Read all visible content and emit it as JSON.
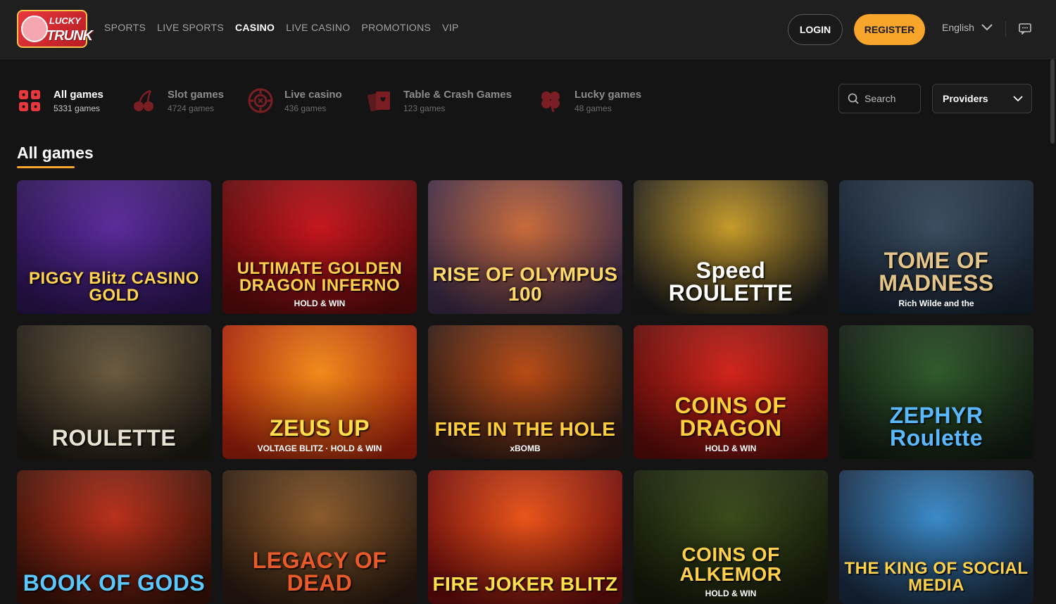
{
  "brand": {
    "logo_line1": "LUCKY",
    "logo_line2": "TRUNK"
  },
  "nav": [
    {
      "label": "SPORTS",
      "active": false
    },
    {
      "label": "LIVE SPORTS",
      "active": false
    },
    {
      "label": "CASINO",
      "active": true
    },
    {
      "label": "LIVE CASINO",
      "active": false
    },
    {
      "label": "PROMOTIONS",
      "active": false
    },
    {
      "label": "VIP",
      "active": false
    }
  ],
  "header": {
    "login_label": "LOGIN",
    "register_label": "REGISTER",
    "language": "English"
  },
  "categories": [
    {
      "title": "All games",
      "count": "5331 games",
      "icon": "grid-icon",
      "active": true
    },
    {
      "title": "Slot games",
      "count": "4724 games",
      "icon": "cherry-icon",
      "active": false
    },
    {
      "title": "Live casino",
      "count": "436 games",
      "icon": "roulette-chip-icon",
      "active": false
    },
    {
      "title": "Table & Crash Games",
      "count": "123 games",
      "icon": "cards-icon",
      "active": false
    },
    {
      "title": "Lucky games",
      "count": "48 games",
      "icon": "clover-icon",
      "active": false
    }
  ],
  "filters": {
    "search_label": "Search",
    "providers_label": "Providers"
  },
  "section": {
    "title": "All games"
  },
  "games": [
    {
      "title": "PIGGY Blitz CASINO GOLD",
      "sub": "",
      "bg": "#5a2a9a",
      "bg2": "#2a1450",
      "fg": "#ffd34d"
    },
    {
      "title": "ULTIMATE GOLDEN DRAGON INFERNO",
      "sub": "HOLD & WIN",
      "bg": "#c4161c",
      "bg2": "#5a0a0c",
      "fg": "#ffcf4a"
    },
    {
      "title": "RISE OF OLYMPUS 100",
      "sub": "",
      "bg": "#c86a3a",
      "bg2": "#3a2a48",
      "fg": "#ffd86a"
    },
    {
      "title": "Speed ROULETTE",
      "sub": "",
      "bg": "#c59a2a",
      "bg2": "#1c1c1c",
      "fg": "#ffffff"
    },
    {
      "title": "TOME OF MADNESS",
      "sub": "Rich Wilde and the",
      "bg": "#3a4c5e",
      "bg2": "#162230",
      "fg": "#e6c58a"
    },
    {
      "title": "ROULETTE",
      "sub": "",
      "bg": "#6a5a3e",
      "bg2": "#1e1a14",
      "fg": "#e8e2d2"
    },
    {
      "title": "ZEUS UP",
      "sub": "VOLTAGE BLITZ · HOLD & WIN",
      "bg": "#f08a1a",
      "bg2": "#a2200c",
      "fg": "#ffe04a"
    },
    {
      "title": "FIRE IN THE HOLE",
      "sub": "xBOMB",
      "bg": "#b84a14",
      "bg2": "#2a1a16",
      "fg": "#ffcc3a"
    },
    {
      "title": "COINS OF DRAGON",
      "sub": "HOLD & WIN",
      "bg": "#d0241a",
      "bg2": "#5a0c0a",
      "fg": "#ffcf3a"
    },
    {
      "title": "ZEPHYR Roulette",
      "sub": "",
      "bg": "#2e5a2a",
      "bg2": "#121a12",
      "fg": "#5ab8ff"
    },
    {
      "title": "BOOK OF GODS",
      "sub": "",
      "bg": "#b8301a",
      "bg2": "#3a1208",
      "fg": "#5ac8ff"
    },
    {
      "title": "LEGACY OF DEAD",
      "sub": "",
      "bg": "#8a5a2a",
      "bg2": "#2a1a10",
      "fg": "#e85a2a"
    },
    {
      "title": "FIRE JOKER BLITZ",
      "sub": "",
      "bg": "#e8541a",
      "bg2": "#6a0c0c",
      "fg": "#ffe04a"
    },
    {
      "title": "COINS OF ALKEMOR",
      "sub": "HOLD & WIN",
      "bg": "#3a4a1a",
      "bg2": "#141a0a",
      "fg": "#ffd04a"
    },
    {
      "title": "THE KING OF SOCIAL MEDIA",
      "sub": "",
      "bg": "#3a8ac8",
      "bg2": "#1a2a40",
      "fg": "#ffd04a"
    }
  ]
}
